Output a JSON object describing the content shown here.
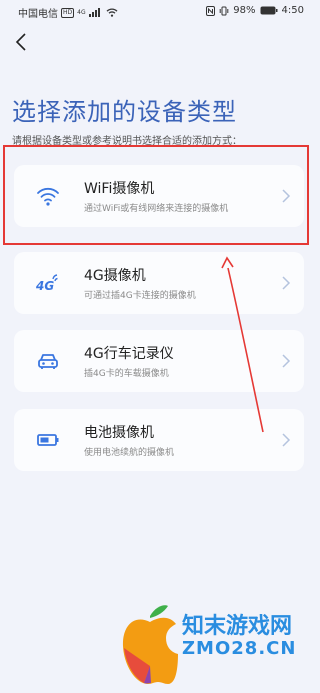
{
  "status_bar": {
    "carrier": "中国电信",
    "hd": "HD",
    "network": "4G",
    "battery": "98%",
    "time": "4:50"
  },
  "page": {
    "title": "选择添加的设备类型",
    "subtitle": "请根据设备类型或参考说明书选择合适的添加方式："
  },
  "devices": [
    {
      "icon": "wifi-icon",
      "title": "WiFi摄像机",
      "desc": "通过WiFi或有线网络来连接的摄像机"
    },
    {
      "icon": "4g-icon",
      "title": "4G摄像机",
      "desc": "可通过插4G卡连接的摄像机"
    },
    {
      "icon": "car-icon",
      "title": "4G行车记录仪",
      "desc": "插4G卡的车载摄像机"
    },
    {
      "icon": "battery-icon",
      "title": "电池摄像机",
      "desc": "使用电池续航的摄像机"
    }
  ],
  "watermark": {
    "line1": "知末游戏网",
    "line2": "ZMO28.CN"
  },
  "colors": {
    "title": "#3b63b8",
    "icon": "#3a76e0",
    "highlight": "#e53935",
    "background": "#f1f3fa"
  }
}
